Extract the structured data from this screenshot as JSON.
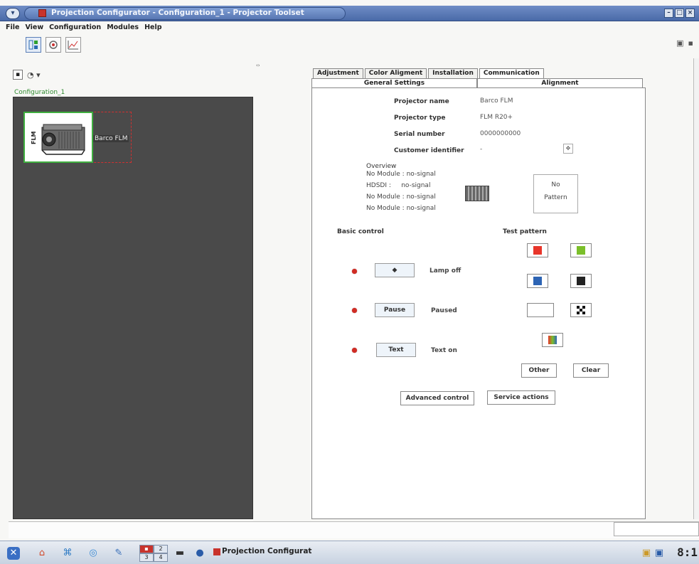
{
  "window": {
    "title": "Projection Configurator - Configuration_1 - Projector Toolset",
    "buttons": [
      "–",
      "□",
      "×"
    ]
  },
  "menu": [
    "File",
    "View",
    "Configuration",
    "Modules",
    "Help"
  ],
  "left": {
    "config_label": "Configuration_1",
    "device_side_label": "FLM",
    "device_name": "Barco FLM"
  },
  "tabs_top": [
    "Adjustment",
    "Color Aligment",
    "Installation",
    "Communication"
  ],
  "tabs_second": [
    "General Settings",
    "Alignment"
  ],
  "general": {
    "projector_name_label": "Projector name",
    "projector_name": "Barco FLM",
    "projector_type_label": "Projector type",
    "projector_type": "FLM R20+",
    "serial_number_label": "Serial number",
    "serial_number": "0000000000",
    "customer_id_label": "Customer identifier",
    "customer_id": "-"
  },
  "overview": {
    "title": "Overview",
    "lines": [
      "No Module : no-signal",
      "HDSDI :     no-signal",
      "No Module : no-signal",
      "No Module : no-signal"
    ],
    "pattern_line1": "No",
    "pattern_line2": "Pattern"
  },
  "basic_control": {
    "title": "Basic control",
    "lamp_button": "◆",
    "lamp_status": "Lamp off",
    "pause_button": "Pause",
    "pause_status": "Paused",
    "text_button": "Text",
    "text_status": "Text on"
  },
  "test_pattern": {
    "title": "Test pattern",
    "colors": {
      "red": "#e8352a",
      "green": "#7bbf2a",
      "blue": "#2d64b4",
      "black": "#222222"
    },
    "other_label": "Other",
    "clear_label": "Clear"
  },
  "actions": {
    "advanced": "Advanced control",
    "service": "Service actions"
  },
  "taskbar": {
    "task_label": "Projection Configurat",
    "pager": [
      "2",
      "3",
      "4"
    ],
    "clock": "8:1"
  }
}
